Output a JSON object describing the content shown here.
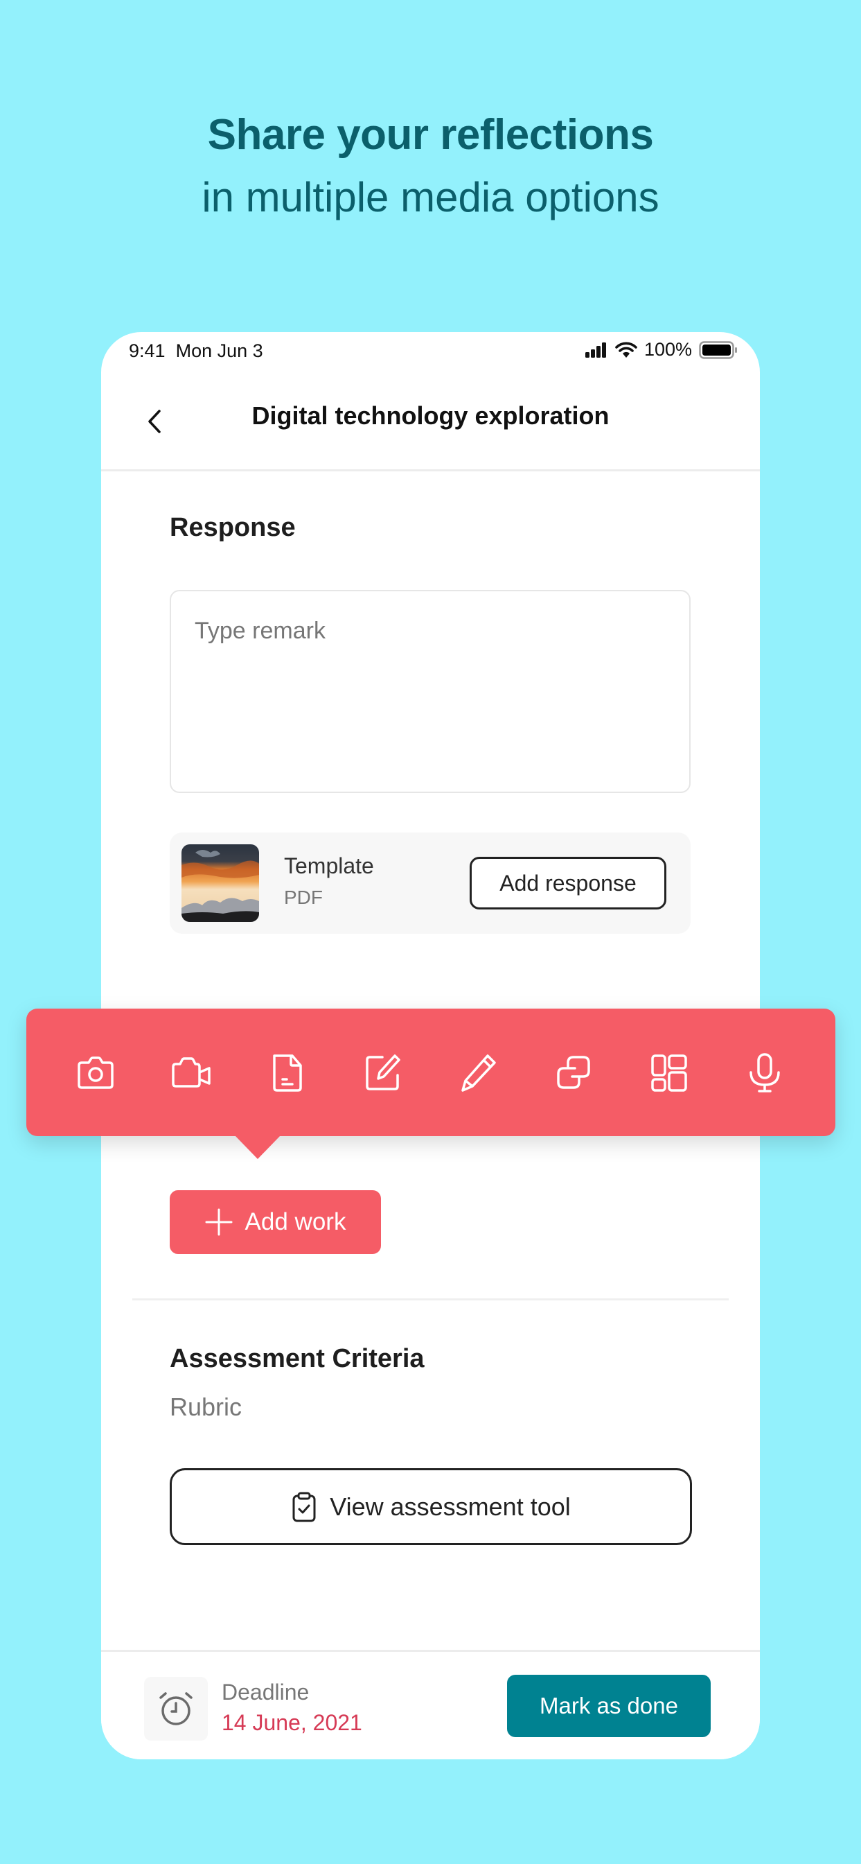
{
  "headline": {
    "line1": "Share your reflections",
    "line2": "in multiple media options"
  },
  "status_bar": {
    "time": "9:41",
    "date": "Mon Jun 3",
    "battery": "100%",
    "icons": [
      "signal-icon",
      "wifi-icon",
      "battery-icon"
    ]
  },
  "nav": {
    "back_icon": "chevron-left-icon",
    "title": "Digital technology exploration"
  },
  "response": {
    "title": "Response",
    "remark_placeholder": "Type remark",
    "remark_value": "",
    "attachment": {
      "name": "Template",
      "type": "PDF",
      "thumbnail": "sunset-image",
      "action_label": "Add response"
    }
  },
  "media_toolbar": {
    "color": "#f55c66",
    "options": [
      {
        "name": "camera",
        "icon": "camera-icon"
      },
      {
        "name": "video",
        "icon": "video-camera-icon"
      },
      {
        "name": "document",
        "icon": "file-icon"
      },
      {
        "name": "note",
        "icon": "edit-note-icon"
      },
      {
        "name": "draw",
        "icon": "pencil-icon"
      },
      {
        "name": "link",
        "icon": "link-icon"
      },
      {
        "name": "apps",
        "icon": "grid-icon"
      },
      {
        "name": "audio",
        "icon": "microphone-icon"
      }
    ]
  },
  "add_work": {
    "icon": "plus-icon",
    "label": "Add work"
  },
  "assessment": {
    "title": "Assessment Criteria",
    "subtitle": "Rubric",
    "button_icon": "clipboard-check-icon",
    "button_label": "View assessment tool"
  },
  "footer": {
    "deadline_icon": "alarm-clock-icon",
    "deadline_label": "Deadline",
    "deadline_date": "14 June, 2021",
    "mark_done_label": "Mark as done"
  },
  "colors": {
    "background": "#93f1fc",
    "headline": "#0b5f6b",
    "accent_red": "#f55c66",
    "accent_teal": "#008291",
    "deadline_date": "#d63a55"
  }
}
